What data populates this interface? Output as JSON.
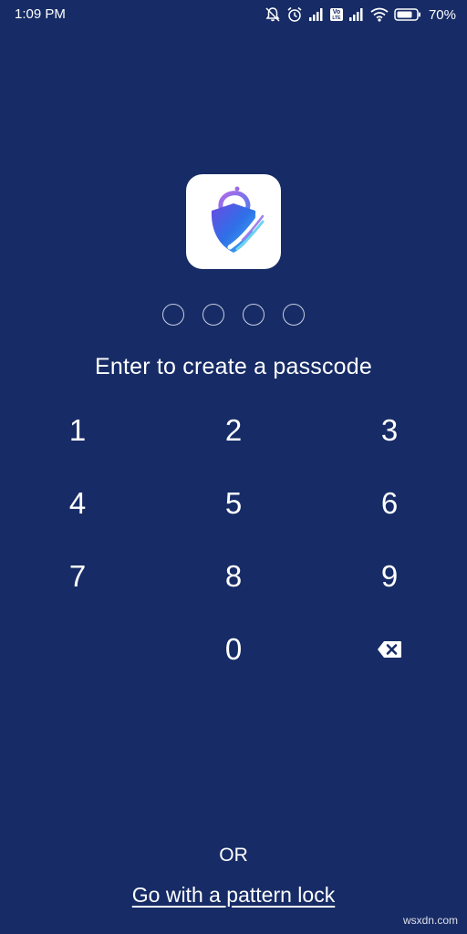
{
  "status_bar": {
    "time": "1:09 PM",
    "battery_percent": "70%",
    "icons": [
      "mute-bell-icon",
      "alarm-icon",
      "signal-icon",
      "volte-icon",
      "signal-icon",
      "wifi-icon",
      "battery-icon"
    ],
    "volte_label_top": "Vo",
    "volte_label_bottom": "LTE"
  },
  "app_logo": {
    "icon": "shield-lock-logo-icon",
    "colors": [
      "#7b4fe0",
      "#2b7bef",
      "#4cc6f0"
    ]
  },
  "passcode": {
    "length": 4,
    "entered": 0
  },
  "instruction": "Enter to create a passcode",
  "keypad": {
    "keys": [
      "1",
      "2",
      "3",
      "4",
      "5",
      "6",
      "7",
      "8",
      "9",
      "0"
    ],
    "backspace_icon": "backspace-icon"
  },
  "footer": {
    "or_label": "OR",
    "pattern_link": "Go with a pattern lock"
  },
  "watermark": "wsxdn.com",
  "colors": {
    "background": "#172c66",
    "text": "#ffffff"
  }
}
